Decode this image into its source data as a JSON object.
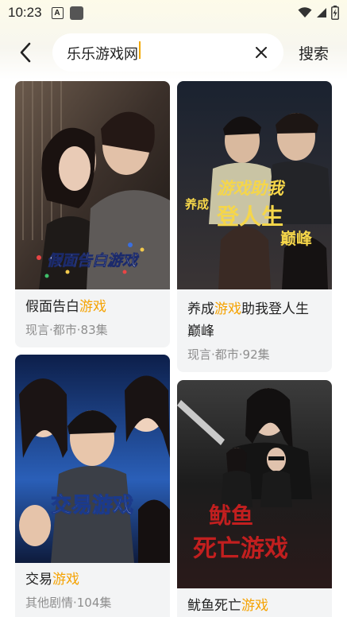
{
  "status": {
    "time": "10:23",
    "notif_letter": "A"
  },
  "search": {
    "value": "乐乐游戏网",
    "button_label": "搜索"
  },
  "results": [
    {
      "title_pre": "假面告白",
      "title_hl": "游戏",
      "title_post": "",
      "meta": "现言·都市·83集",
      "poster_text": "假面告白游戏"
    },
    {
      "title_pre": "养成",
      "title_hl": "游戏",
      "title_post": "助我登人生",
      "title_line2": "巅峰",
      "meta": "现言·都市·92集",
      "poster_text_a": "养成",
      "poster_text_b": "游戏助我",
      "poster_text_c": "登人生",
      "poster_text_d": "巅峰"
    },
    {
      "title_pre": "交易",
      "title_hl": "游戏",
      "title_post": "",
      "meta": "其他剧情·104集",
      "poster_text": "交易游戏"
    },
    {
      "title_pre": "鱿鱼死亡",
      "title_hl": "游戏",
      "title_post": "",
      "poster_text_a": "鱿鱼",
      "poster_text_b": "死亡游戏"
    }
  ],
  "colors": {
    "accent": "#f5a200",
    "card_bg": "#f3f4f5",
    "meta": "#8e8e8e"
  }
}
